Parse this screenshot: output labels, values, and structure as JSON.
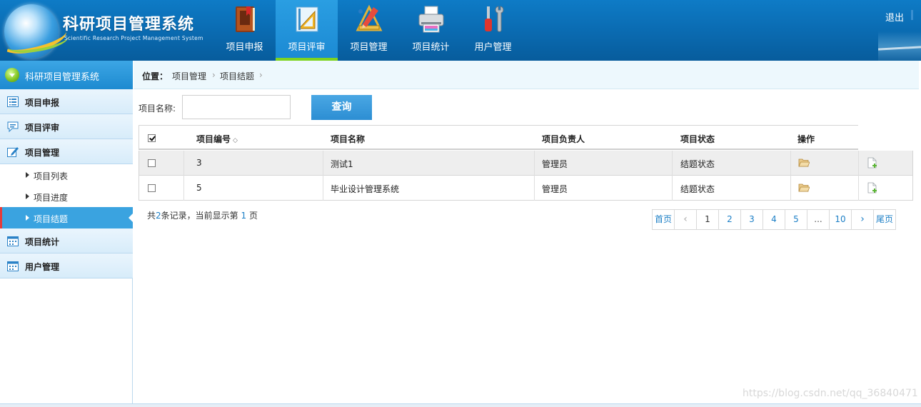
{
  "app": {
    "title_cn": "科研项目管理系统",
    "title_en": "Scientific Research Project Management System",
    "logout": "退出"
  },
  "nav": {
    "items": [
      {
        "label": "项目申报",
        "icon": "book-icon",
        "active": false
      },
      {
        "label": "项目评审",
        "icon": "ruler-triangle-icon",
        "active": true
      },
      {
        "label": "项目管理",
        "icon": "tools-pencil-icon",
        "active": false
      },
      {
        "label": "项目统计",
        "icon": "printer-icon",
        "active": false
      },
      {
        "label": "用户管理",
        "icon": "wrench-screwdriver-icon",
        "active": false
      }
    ]
  },
  "sidebar": {
    "header": "科研项目管理系统",
    "menus": [
      {
        "label": "项目申报",
        "icon": "list-icon"
      },
      {
        "label": "项目评审",
        "icon": "comment-icon"
      },
      {
        "label": "项目管理",
        "icon": "edit-icon"
      },
      {
        "label": "项目统计",
        "icon": "calendar-icon"
      },
      {
        "label": "用户管理",
        "icon": "calendar-icon"
      }
    ],
    "submenu": [
      {
        "label": "项目列表",
        "active": false
      },
      {
        "label": "项目进度",
        "active": false
      },
      {
        "label": "项目结题",
        "active": true
      }
    ]
  },
  "breadcrumb": {
    "position_label": "位置：",
    "level1": "项目管理",
    "level2": "项目结题",
    "separator": "›"
  },
  "search": {
    "label": "项目名称:",
    "value": "",
    "placeholder": "",
    "button": "查询"
  },
  "table": {
    "columns": [
      "项目编号",
      "项目名称",
      "项目负责人",
      "项目状态",
      "操作"
    ],
    "sort_icon": "◇",
    "rows": [
      {
        "id": "3",
        "name": "测试1",
        "leader": "管理员",
        "status": "结题状态"
      },
      {
        "id": "5",
        "name": "毕业设计管理系统",
        "leader": "管理员",
        "status": "结题状态"
      }
    ]
  },
  "summary": {
    "prefix": "共",
    "total": "2",
    "middle": "条记录，当前显示第",
    "page": "1",
    "suffix": "页"
  },
  "pagination": {
    "first": "首页",
    "prev": "‹",
    "pages": [
      "1",
      "2",
      "3",
      "4",
      "5"
    ],
    "ellipsis": "...",
    "last_page": "10",
    "next": "›",
    "last": "尾页",
    "current": "1"
  },
  "watermark": "https://blog.csdn.net/qq_36840471"
}
